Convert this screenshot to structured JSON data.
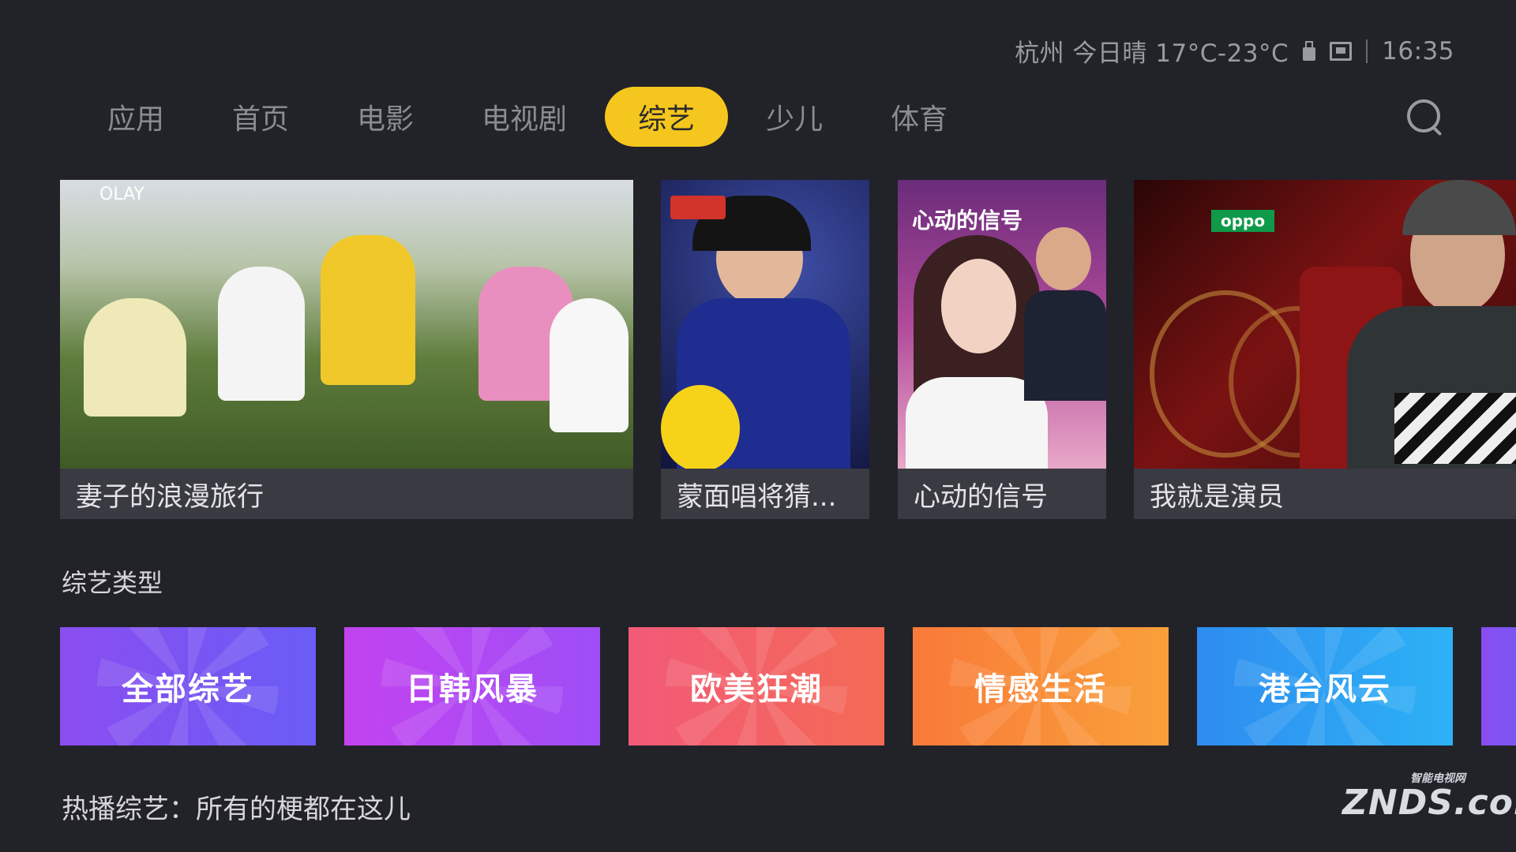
{
  "status": {
    "weather": "杭州  今日晴 17°C-23°C",
    "time": "16:35",
    "usb_icon": "usb-icon",
    "network_icon": "ethernet-icon"
  },
  "nav": {
    "items": [
      {
        "label": "应用"
      },
      {
        "label": "首页"
      },
      {
        "label": "电影"
      },
      {
        "label": "电视剧"
      },
      {
        "label": "综艺"
      },
      {
        "label": "少儿"
      },
      {
        "label": "体育"
      }
    ],
    "active_index": 4,
    "search_icon": "search-icon",
    "active_color": "#f5c61d"
  },
  "featured": [
    {
      "title": "妻子的浪漫旅行",
      "poster_logo": "OLAY"
    },
    {
      "title": "蒙面唱将猜..."
    },
    {
      "title": "心动的信号",
      "poster_logo": "心动的信号"
    },
    {
      "title": "我就是演员",
      "poster_logo": "oppo"
    }
  ],
  "section": {
    "title": "综艺类型"
  },
  "categories": [
    {
      "label": "全部综艺",
      "colors": [
        "#8a4df0",
        "#6a5cf5"
      ]
    },
    {
      "label": "日韩风暴",
      "colors": [
        "#c343f0",
        "#9e4ef6"
      ]
    },
    {
      "label": "欧美狂潮",
      "colors": [
        "#f25a78",
        "#f46a55"
      ]
    },
    {
      "label": "情感生活",
      "colors": [
        "#f97a39",
        "#f9a03a"
      ]
    },
    {
      "label": "港台风云",
      "colors": [
        "#2e8cf0",
        "#2db2f5"
      ]
    }
  ],
  "bottom_title": "热播综艺：所有的梗都在这儿",
  "watermark": {
    "small": "智能电视网",
    "big": "ZNDS.com"
  }
}
